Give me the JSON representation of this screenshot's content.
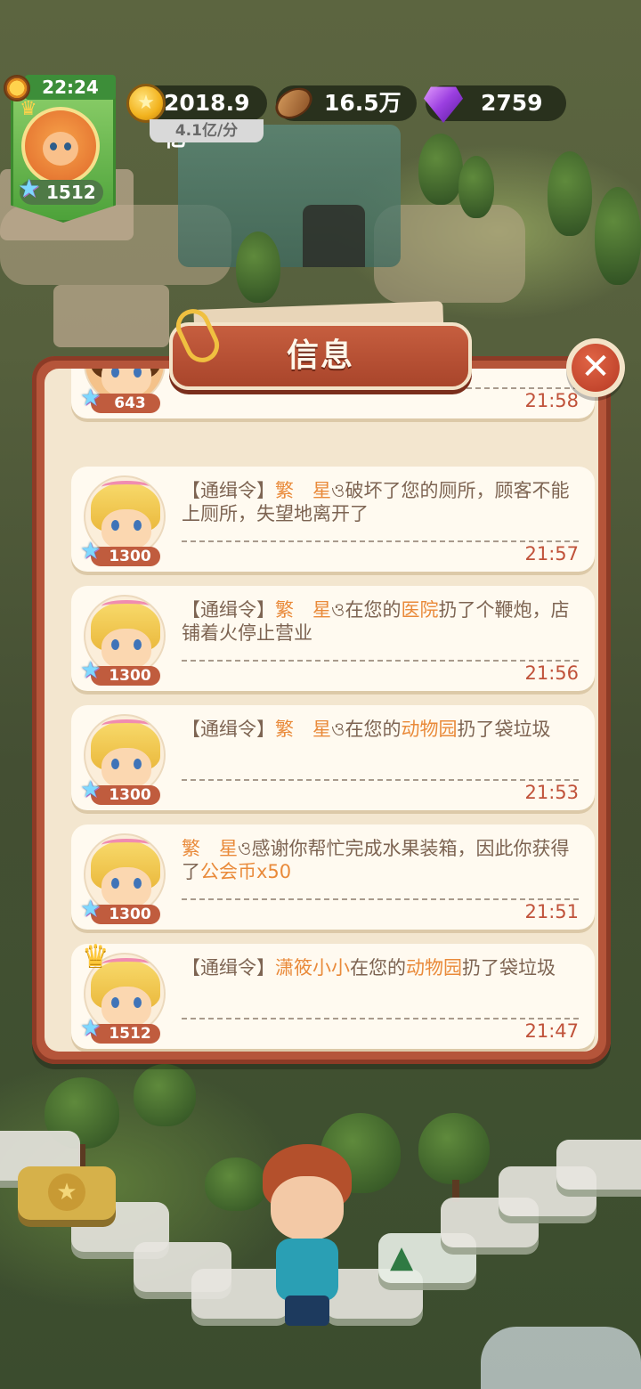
{
  "hud": {
    "clock": "22:24",
    "player_level": "1512",
    "coins": "2018.9亿",
    "coin_rate": "4.1亿/分",
    "wood": "16.5万",
    "gems": "2759"
  },
  "dialog": {
    "title": "信息",
    "close_label": "✕"
  },
  "messages": [
    {
      "level": "643",
      "text_parts": [],
      "time": "21:58"
    },
    {
      "level": "1300",
      "text_parts": [
        "【通缉令】",
        "繁　星",
        "ও破坏了您的厕所，顾客不能上厕所，失望地离开了"
      ],
      "time": "21:57"
    },
    {
      "level": "1300",
      "text_parts": [
        "【通缉令】",
        "繁　星",
        "ও在您的",
        "医院",
        "扔了个鞭炮，店铺着火停止营业"
      ],
      "time": "21:56"
    },
    {
      "level": "1300",
      "text_parts": [
        "【通缉令】",
        "繁　星",
        "ও在您的",
        "动物园",
        "扔了袋垃圾"
      ],
      "time": "21:53"
    },
    {
      "level": "1300",
      "text_parts": [
        "繁　星",
        "ও感谢你帮忙完成水果装箱，因此你获得了",
        "公会币x50"
      ],
      "time": "21:51"
    },
    {
      "level": "1512",
      "text_parts": [
        "【通缉令】",
        "潇筱小小",
        "在您的",
        "动物园",
        "扔了袋垃圾"
      ],
      "time": "21:47"
    }
  ],
  "icons": {
    "coin": "coin-icon",
    "wood": "wood-icon",
    "gem": "gem-icon",
    "level_star": "star-icon",
    "close": "close-icon",
    "crown": "crown-icon",
    "paperclip": "paperclip-icon",
    "weather": "sun-icon"
  },
  "colors": {
    "dialog_frame": "#b5553a",
    "dialog_body": "#f3e6cf",
    "highlight_text": "#e98a3a",
    "body_text": "#7d6452",
    "time_text": "#c0523a"
  }
}
